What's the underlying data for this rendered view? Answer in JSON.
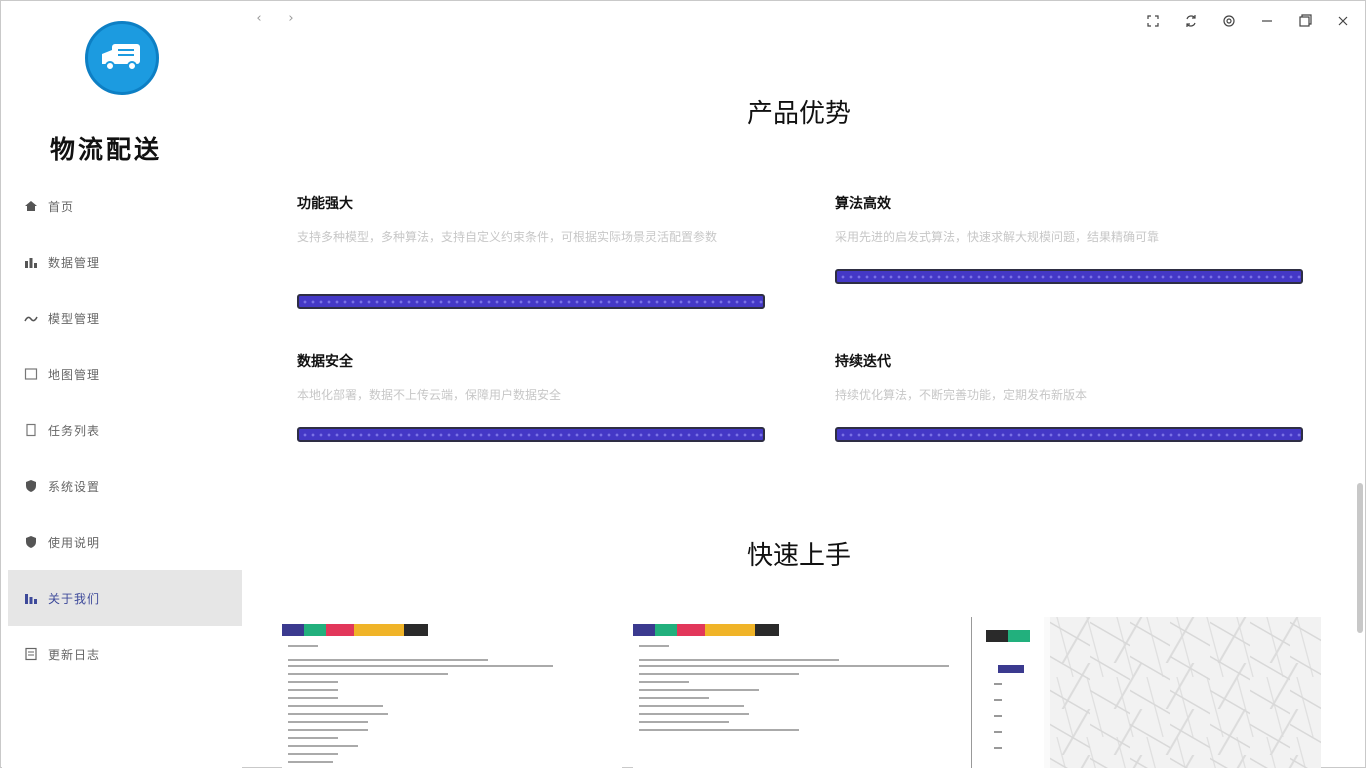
{
  "app": {
    "name": "物流配送"
  },
  "sidebar": {
    "items": [
      {
        "label": "首页",
        "icon": "home-icon",
        "active": false
      },
      {
        "label": "数据管理",
        "icon": "bar-chart-icon",
        "active": false
      },
      {
        "label": "模型管理",
        "icon": "wave-icon",
        "active": false
      },
      {
        "label": "地图管理",
        "icon": "map-icon",
        "active": false
      },
      {
        "label": "任务列表",
        "icon": "document-icon",
        "active": false
      },
      {
        "label": "系统设置",
        "icon": "shield-icon",
        "active": false
      },
      {
        "label": "使用说明",
        "icon": "shield-icon",
        "active": false
      },
      {
        "label": "关于我们",
        "icon": "bar-chart-icon",
        "active": true
      },
      {
        "label": "更新日志",
        "icon": "list-icon",
        "active": false
      }
    ]
  },
  "topbar": {
    "back": "‹",
    "forward": "›"
  },
  "advantages": {
    "title": "产品优势",
    "features": [
      {
        "title": "功能强大",
        "desc": "支持多种模型，多种算法，支持自定义约束条件，可根据实际场景灵活配置参数"
      },
      {
        "title": "算法高效",
        "desc": "采用先进的启发式算法，快速求解大规模问题，结果精确可靠"
      },
      {
        "title": "数据安全",
        "desc": "本地化部署，数据不上传云端，保障用户数据安全"
      },
      {
        "title": "持续迭代",
        "desc": "持续优化算法，不断完善功能，定期发布新版本"
      }
    ]
  },
  "quickstart": {
    "title": "快速上手"
  },
  "colors": {
    "accent": "#4438c6",
    "brand": "#1c9be0"
  }
}
